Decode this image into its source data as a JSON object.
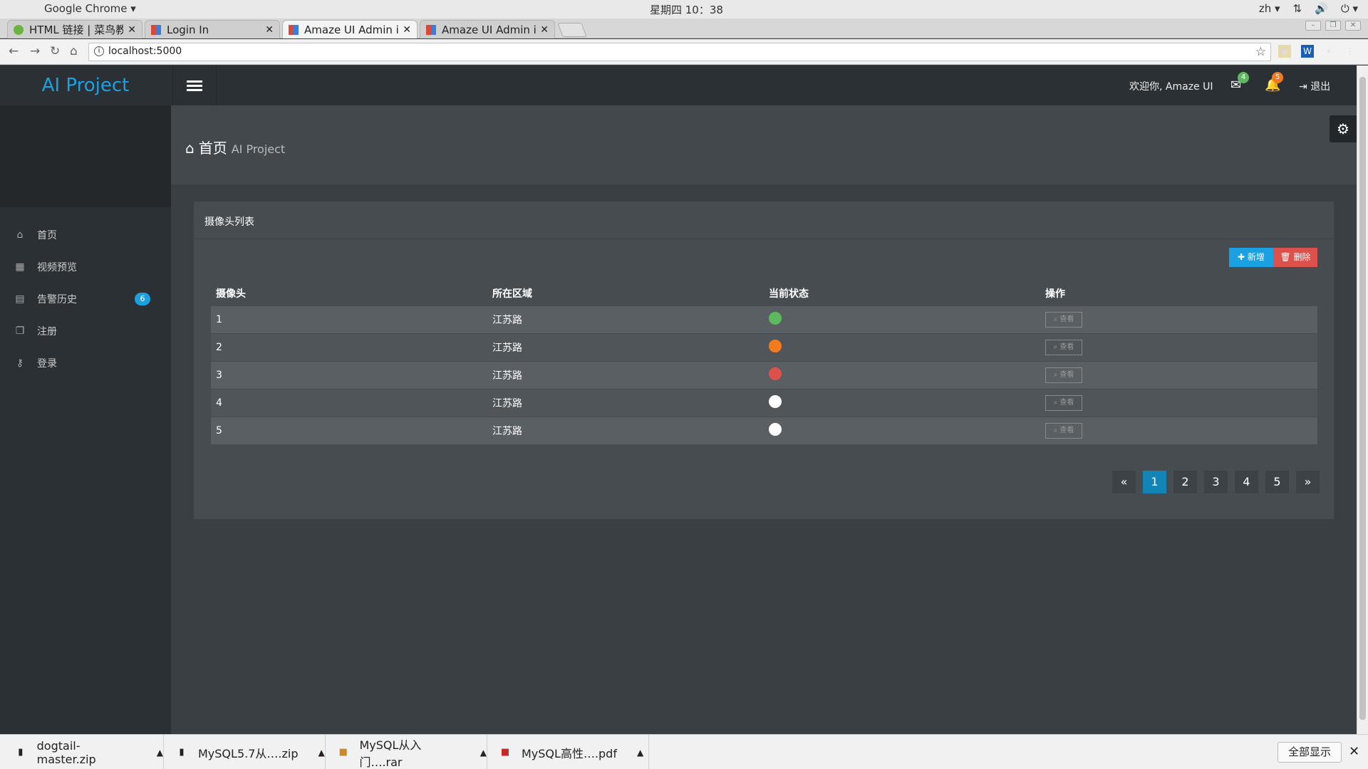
{
  "os": {
    "app": "Google Chrome",
    "clock": "星期四 10：38",
    "lang": "zh"
  },
  "tabs": [
    {
      "title": "HTML 链接 | 菜鸟教程"
    },
    {
      "title": "Login In"
    },
    {
      "title": "Amaze UI Admin index"
    },
    {
      "title": "Amaze UI Admin index"
    }
  ],
  "address": {
    "url": "localhost:5000"
  },
  "header": {
    "logo": "AI Project",
    "welcome": "欢迎你, Amaze UI",
    "mail_count": "4",
    "bell_count": "5",
    "logout": "退出"
  },
  "sidebar": {
    "items": [
      {
        "label": "首页",
        "icon": "home-icon"
      },
      {
        "label": "视频预览",
        "icon": "table-icon"
      },
      {
        "label": "告警历史",
        "icon": "calendar-icon",
        "badge": "6"
      },
      {
        "label": "注册",
        "icon": "copy-icon"
      },
      {
        "label": "登录",
        "icon": "key-icon"
      }
    ]
  },
  "page": {
    "title": "首页",
    "subtitle": "AI Project"
  },
  "panel": {
    "title": "摄像头列表",
    "add_label": "新增",
    "delete_label": "删除"
  },
  "table": {
    "headers": [
      "摄像头",
      "所在区域",
      "当前状态",
      "操作"
    ],
    "rows": [
      {
        "id": "1",
        "area": "江苏路",
        "status_color": "#5eb95e",
        "action": "查看"
      },
      {
        "id": "2",
        "area": "江苏路",
        "status_color": "#f37b1d",
        "action": "查看"
      },
      {
        "id": "3",
        "area": "江苏路",
        "status_color": "#dd514c",
        "action": "查看"
      },
      {
        "id": "4",
        "area": "江苏路",
        "status_color": "#ffffff",
        "action": "查看"
      },
      {
        "id": "5",
        "area": "江苏路",
        "status_color": "#ffffff",
        "action": "查看"
      }
    ]
  },
  "pagination": {
    "prev": "«",
    "pages": [
      "1",
      "2",
      "3",
      "4",
      "5"
    ],
    "next": "»",
    "current": "1"
  },
  "downloads": {
    "items": [
      {
        "name": "dogtail-master.zip"
      },
      {
        "name": "MySQL5.7从….zip"
      },
      {
        "name": "MySQL从入门….rar"
      },
      {
        "name": "MySQL高性….pdf"
      }
    ],
    "show_all": "全部显示"
  }
}
